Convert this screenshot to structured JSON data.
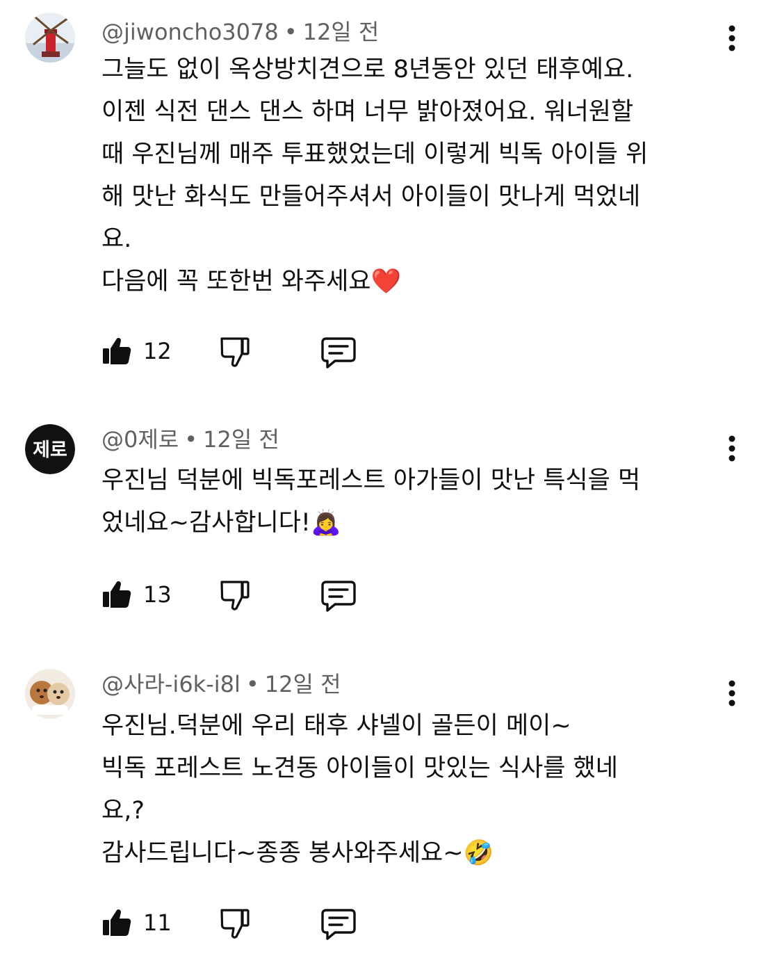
{
  "comments": [
    {
      "author": "@jiwoncho3078",
      "separator": "•",
      "time": "12일 전",
      "avatar": "windmill-photo",
      "lines": [
        "그늘도 없이 옥상방치견으로 8년동안 있던 태후예요.",
        "이젠  식전 댄스 댄스 하며 너무 밝아졌어요.  워너원할",
        "때 우진님께 매주 투표했었는데 이렇게 빅독 아이들 위",
        "해 맛난 화식도 만들어주셔서 아이들이 맛나게 먹었네",
        "요.",
        "다음에 꼭 또한번 와주세요"
      ],
      "emoji": "❤️",
      "likes": "12"
    },
    {
      "author": "@0제로",
      "separator": "•",
      "time": "12일 전",
      "avatar_text": "제로",
      "lines": [
        "우진님 덕분에 빅독포레스트 아가들이 맛난 특식을 먹",
        "었네요~감사합니다!"
      ],
      "emoji": "🙇‍♀️",
      "likes": "13"
    },
    {
      "author": "@사라-i6k-i8l",
      "separator": "•",
      "time": "12일 전",
      "avatar": "dogs-photo",
      "lines": [
        "우진님.덕분에 우리 태후 샤넬이 골든이 메이~",
        "빅독 포레스트 노견동 아이들이 맛있는 식사를 했네",
        "요,?",
        "감사드립니다~종종 봉사와주세요~"
      ],
      "emoji": "🤣",
      "likes": "11"
    }
  ],
  "icons": {
    "like": "thumbs-up-icon",
    "dislike": "thumbs-down-icon",
    "reply": "reply-comment-icon",
    "menu": "more-vertical-icon"
  },
  "colors": {
    "text": "#0f0f0f",
    "meta": "#606060",
    "heart": "#e0242b"
  }
}
